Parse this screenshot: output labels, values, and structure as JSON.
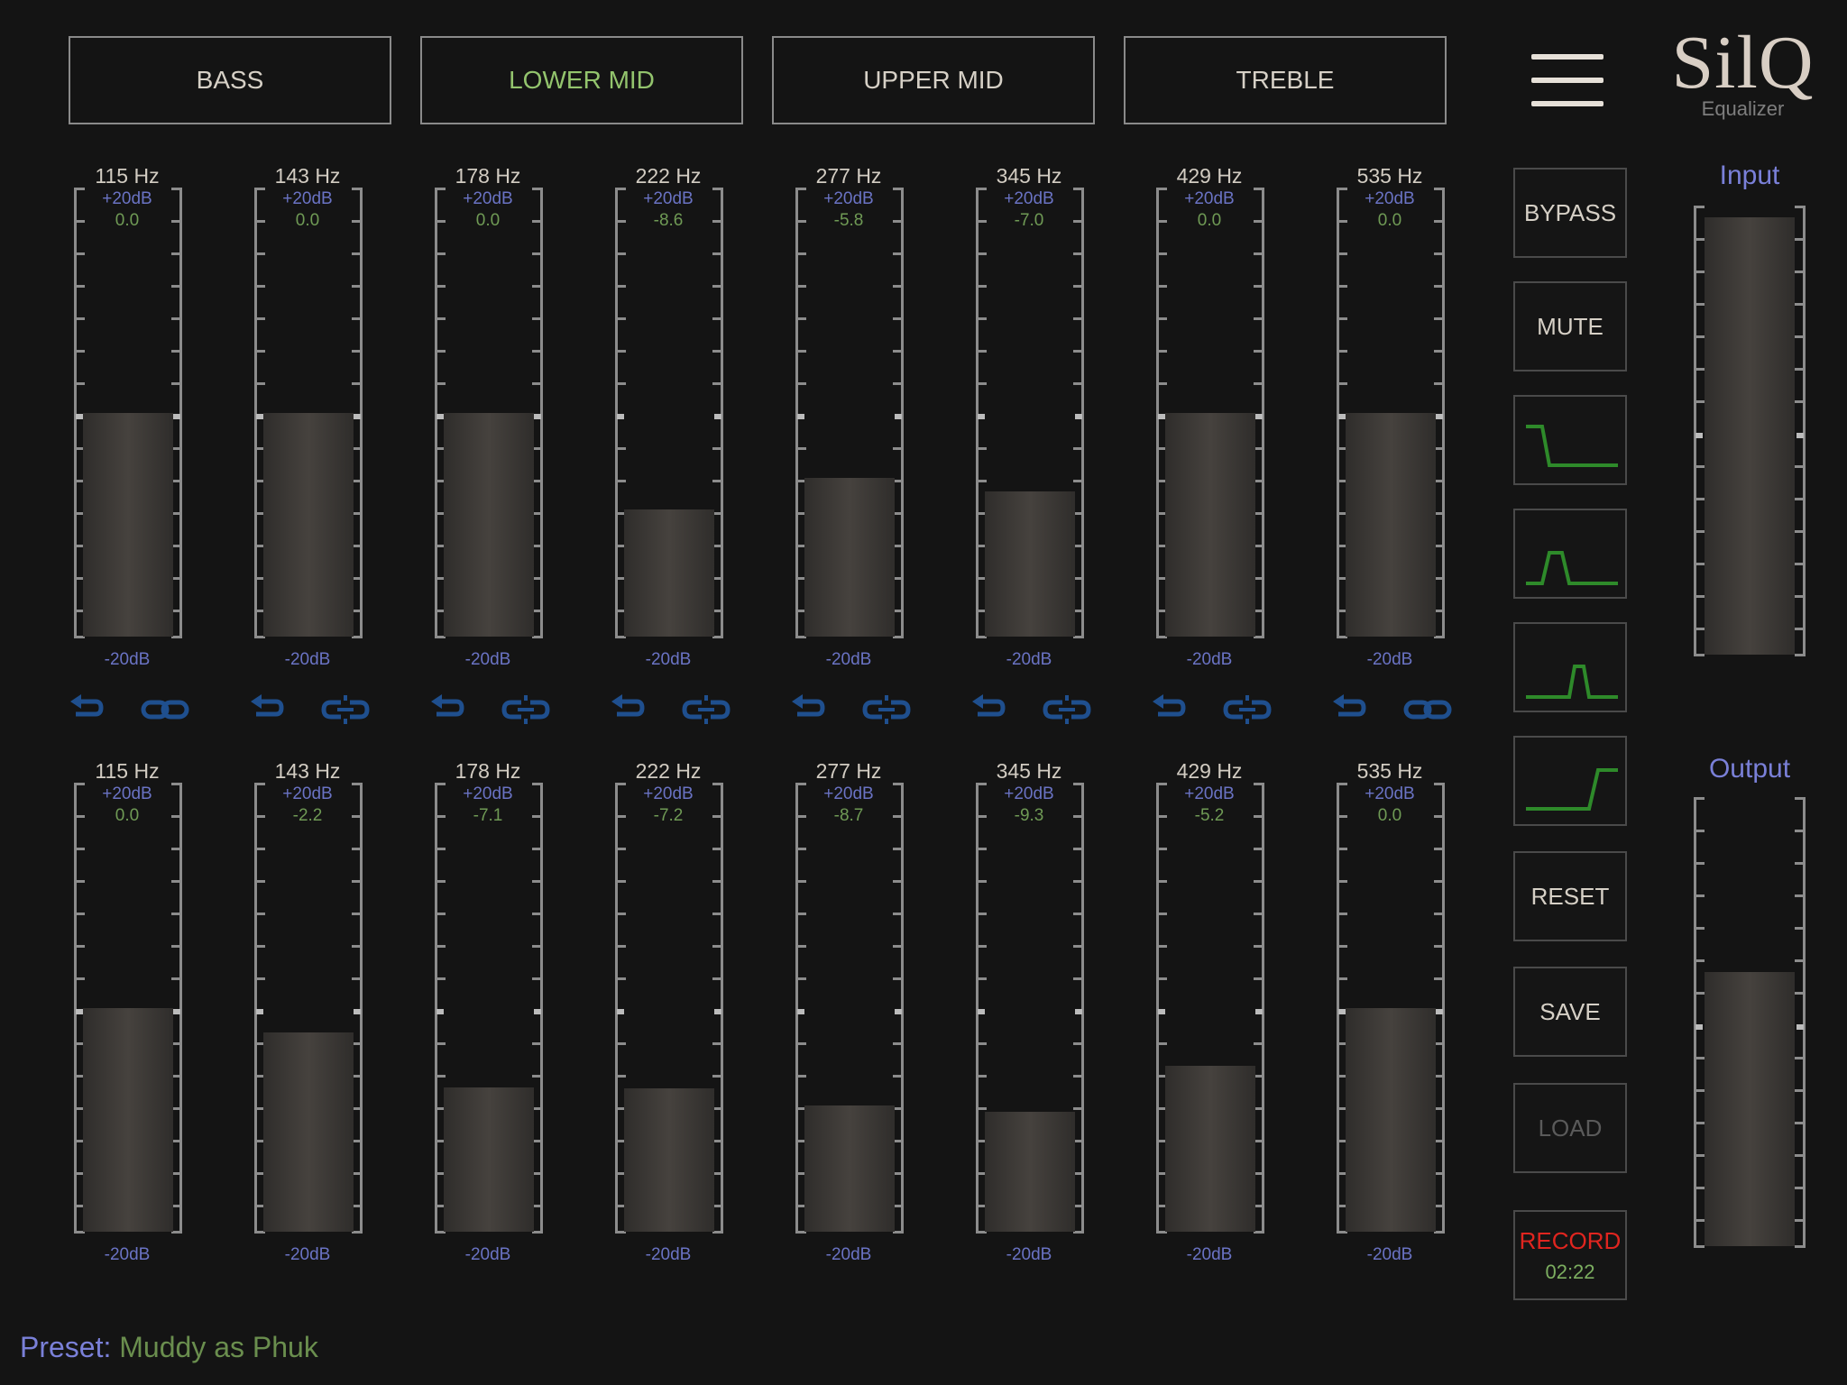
{
  "app": {
    "logo_name": "SilQ",
    "logo_sub": "Equalizer"
  },
  "tabs": [
    {
      "label": "BASS",
      "active": false
    },
    {
      "label": "LOWER MID",
      "active": true
    },
    {
      "label": "UPPER MID",
      "active": false
    },
    {
      "label": "TREBLE",
      "active": false
    }
  ],
  "scale": {
    "top_label": "+20dB",
    "bottom_label": "-20dB",
    "max_db": 20,
    "min_db": -20
  },
  "left_channel": [
    {
      "freq": "115 Hz",
      "value": "0.0"
    },
    {
      "freq": "143 Hz",
      "value": "0.0"
    },
    {
      "freq": "178 Hz",
      "value": "0.0"
    },
    {
      "freq": "222 Hz",
      "value": "-8.6"
    },
    {
      "freq": "277 Hz",
      "value": "-5.8"
    },
    {
      "freq": "345 Hz",
      "value": "-7.0"
    },
    {
      "freq": "429 Hz",
      "value": "0.0"
    },
    {
      "freq": "535 Hz",
      "value": "0.0"
    }
  ],
  "right_channel": [
    {
      "freq": "115 Hz",
      "value": "0.0"
    },
    {
      "freq": "143 Hz",
      "value": "-2.2"
    },
    {
      "freq": "178 Hz",
      "value": "-7.1"
    },
    {
      "freq": "222 Hz",
      "value": "-7.2"
    },
    {
      "freq": "277 Hz",
      "value": "-8.7"
    },
    {
      "freq": "345 Hz",
      "value": "-9.3"
    },
    {
      "freq": "429 Hz",
      "value": "-5.2"
    },
    {
      "freq": "535 Hz",
      "value": "0.0"
    }
  ],
  "link_states": [
    "linked",
    "unlinked",
    "unlinked",
    "unlinked",
    "unlinked",
    "unlinked",
    "unlinked",
    "linked"
  ],
  "controls": {
    "bypass": "BYPASS",
    "mute": "MUTE",
    "filter_icons": [
      "low-shelf-filter-icon",
      "band-pass-filter-icon",
      "narrow-band-filter-icon",
      "high-shelf-filter-icon"
    ],
    "reset": "RESET",
    "save": "SAVE",
    "load": "LOAD",
    "record": "RECORD",
    "record_time": "02:22"
  },
  "meters": {
    "input_label": "Input",
    "output_label": "Output",
    "input_level": 0.99,
    "output_level": 0.62
  },
  "preset": {
    "label": "Preset:",
    "name": "Muddy as Phuk"
  },
  "colors": {
    "background": "#141414",
    "db_label": "#6a73c4",
    "db_value": "#6f9a55",
    "active_tab": "#93c46d",
    "filter_curve": "#2e8a2a",
    "icon_blue": "#1f4f8e",
    "record": "#e0251f"
  }
}
